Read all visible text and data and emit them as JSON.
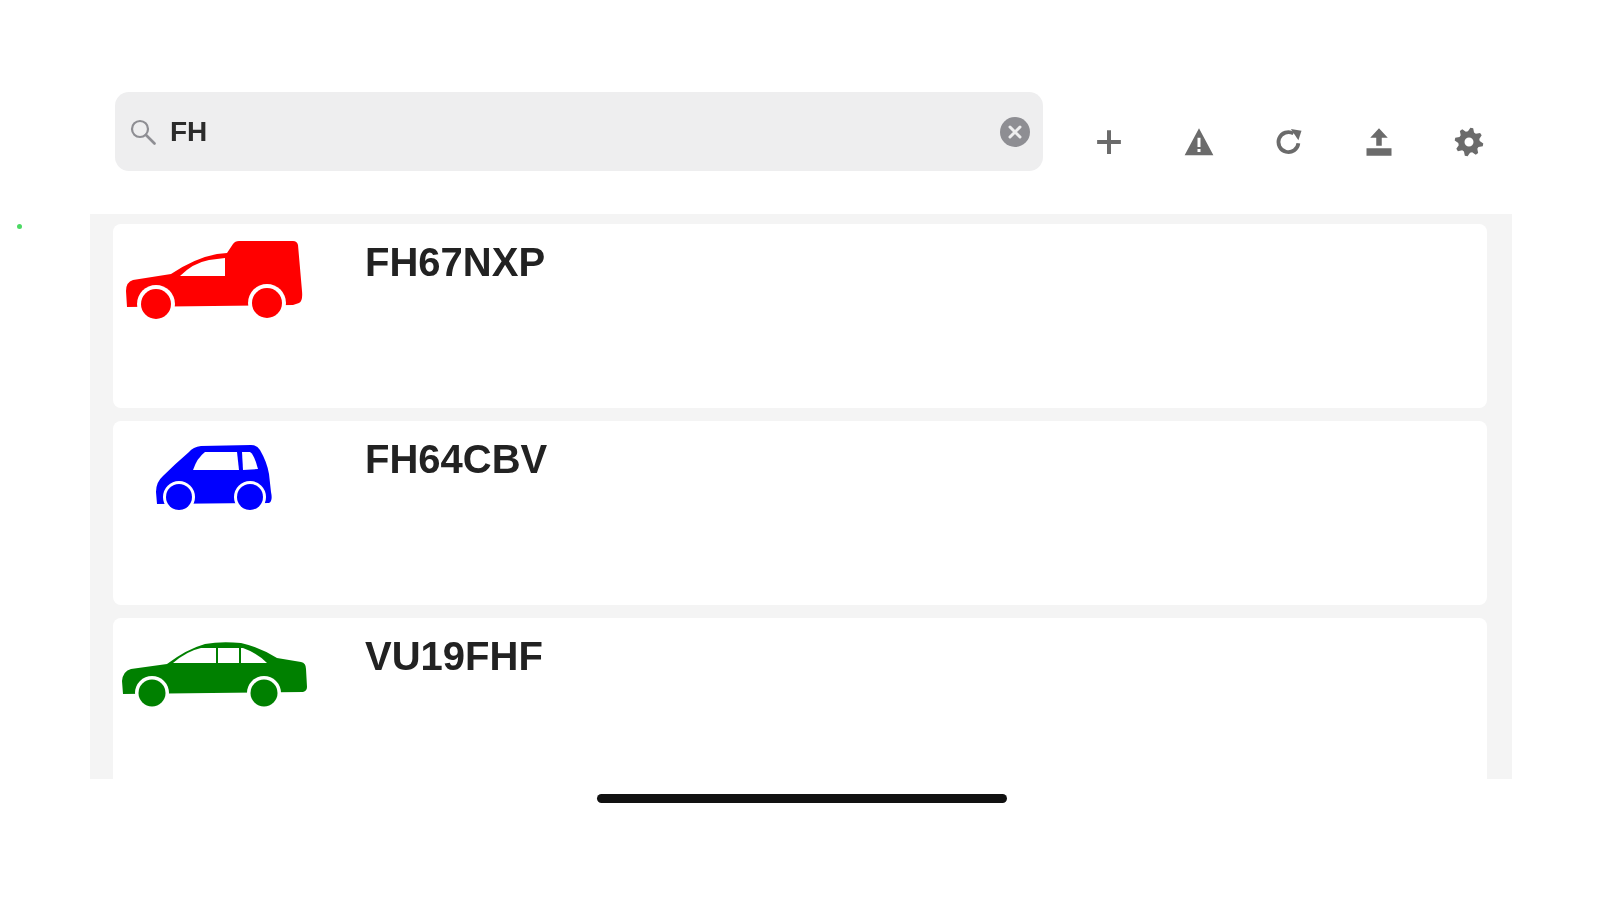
{
  "search": {
    "value": "FH"
  },
  "vehicles": [
    {
      "plate": "FH67NXP",
      "kind": "van",
      "color": "#ff0000"
    },
    {
      "plate": "FH64CBV",
      "kind": "hatchback",
      "color": "#0000ff"
    },
    {
      "plate": "VU19FHF",
      "kind": "sedan",
      "color": "#008000"
    }
  ]
}
